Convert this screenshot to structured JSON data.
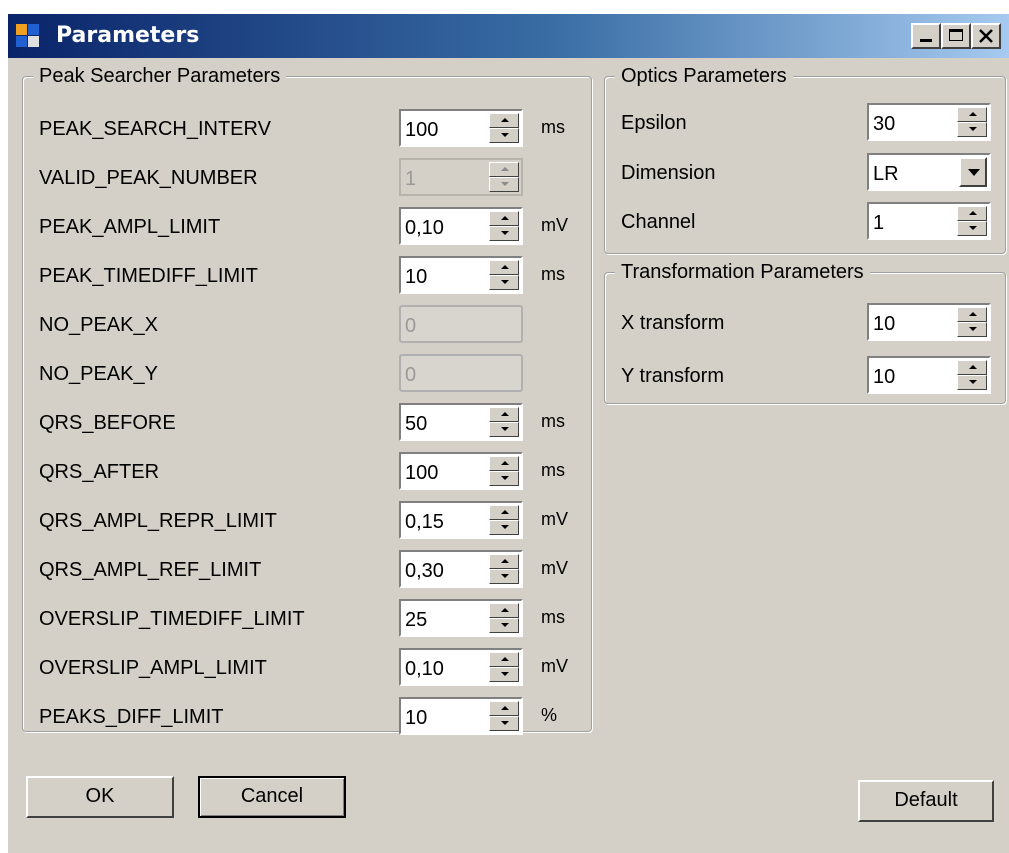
{
  "window": {
    "title": "Parameters"
  },
  "peak": {
    "title": "Peak Searcher Parameters",
    "rows": [
      {
        "label": "PEAK_SEARCH_INTERV",
        "value": "100",
        "unit": "ms"
      },
      {
        "label": "VALID_PEAK_NUMBER",
        "value": "1",
        "unit": ""
      },
      {
        "label": "PEAK_AMPL_LIMIT",
        "value": "0,10",
        "unit": "mV"
      },
      {
        "label": "PEAK_TIMEDIFF_LIMIT",
        "value": "10",
        "unit": "ms"
      },
      {
        "label": "NO_PEAK_X",
        "value": "0",
        "unit": ""
      },
      {
        "label": "NO_PEAK_Y",
        "value": "0",
        "unit": ""
      },
      {
        "label": "QRS_BEFORE",
        "value": "50",
        "unit": "ms"
      },
      {
        "label": "QRS_AFTER",
        "value": "100",
        "unit": "ms"
      },
      {
        "label": "QRS_AMPL_REPR_LIMIT",
        "value": "0,15",
        "unit": "mV"
      },
      {
        "label": "QRS_AMPL_REF_LIMIT",
        "value": "0,30",
        "unit": "mV"
      },
      {
        "label": "OVERSLIP_TIMEDIFF_LIMIT",
        "value": "25",
        "unit": "ms"
      },
      {
        "label": "OVERSLIP_AMPL_LIMIT",
        "value": "0,10",
        "unit": "mV"
      },
      {
        "label": "PEAKS_DIFF_LIMIT",
        "value": "10",
        "unit": "%"
      }
    ]
  },
  "optics": {
    "title": "Optics Parameters",
    "epsilon_label": "Epsilon",
    "epsilon_value": "30",
    "dimension_label": "Dimension",
    "dimension_value": "LR",
    "channel_label": "Channel",
    "channel_value": "1"
  },
  "transform": {
    "title": "Transformation Parameters",
    "x_label": "X transform",
    "x_value": "10",
    "y_label": "Y transform",
    "y_value": "10"
  },
  "buttons": {
    "ok": "OK",
    "cancel": "Cancel",
    "default": "Default"
  }
}
